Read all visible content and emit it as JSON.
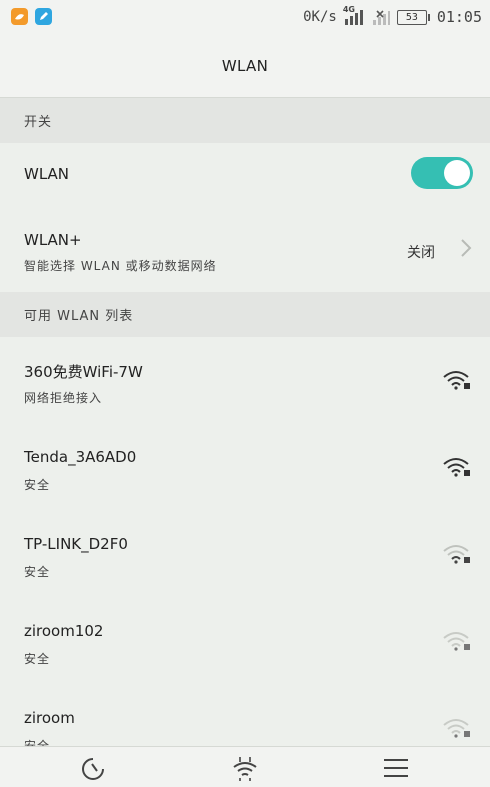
{
  "status_bar": {
    "speed": "0K/s",
    "network": "4G",
    "battery": "53",
    "time": "01:05"
  },
  "header": {
    "title": "WLAN"
  },
  "sections": {
    "switch_header": "开关",
    "list_header": "可用 WLAN 列表"
  },
  "wlan_toggle": {
    "label": "WLAN",
    "state": "on",
    "accent": "#35bfb3"
  },
  "wlan_plus": {
    "title": "WLAN+",
    "subtitle": "智能选择 WLAN 或移动数据网络",
    "value": "关闭"
  },
  "networks": [
    {
      "ssid": "360免费WiFi-7W",
      "status": "网络拒绝接入",
      "signal": "strong"
    },
    {
      "ssid": "Tenda_3A6AD0",
      "status": "安全",
      "signal": "strong"
    },
    {
      "ssid": "TP-LINK_D2F0",
      "status": "安全",
      "signal": "weak"
    },
    {
      "ssid": "ziroom102",
      "status": "安全",
      "signal": "weak"
    },
    {
      "ssid": "ziroom",
      "status": "安全",
      "signal": "weak"
    }
  ],
  "bottom_nav": {
    "icons": [
      "refresh-icon",
      "wifi-direct-icon",
      "menu-icon"
    ]
  }
}
